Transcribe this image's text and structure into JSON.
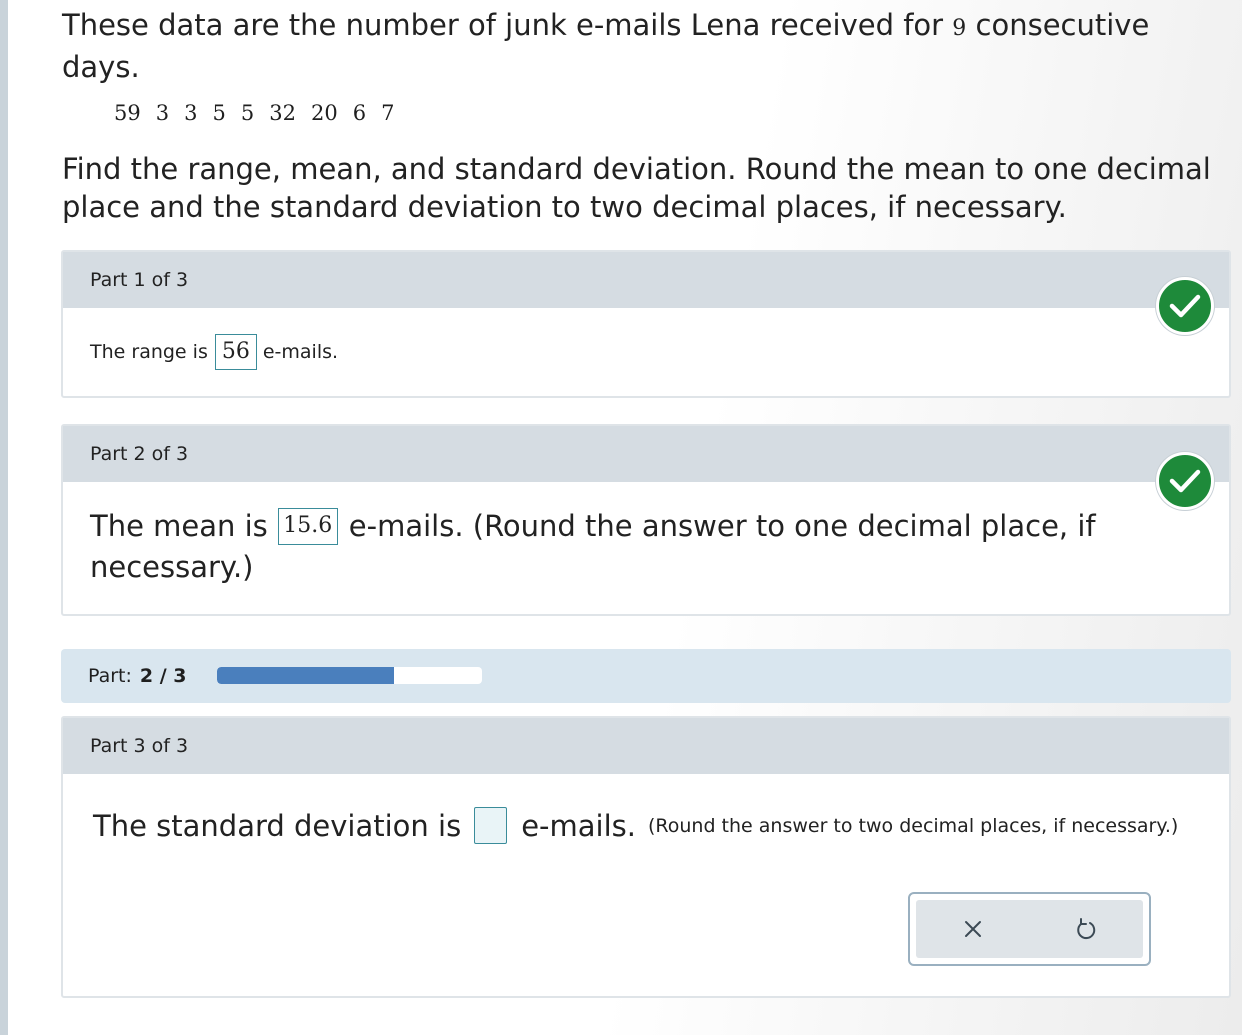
{
  "question": {
    "text_before": "These data are the number of junk e-mails Lena received for",
    "count": "9",
    "text_after": "consecutive days.",
    "values": [
      "59",
      "3",
      "3",
      "5",
      "5",
      "32",
      "20",
      "6",
      "7"
    ],
    "instructions": "Find the range, mean, and standard deviation. Round the mean to one decimal place and the standard deviation to two decimal places, if necessary."
  },
  "part1": {
    "header": "Part 1 of 3",
    "prefix": "The range is",
    "answer": "56",
    "suffix": "e-mails."
  },
  "part2": {
    "header": "Part 2 of 3",
    "prefix": "The mean is",
    "answer": "15.6",
    "suffix": "e-mails. (Round the answer to one decimal place, if",
    "suffix2": "necessary.)"
  },
  "progress": {
    "label": "Part:",
    "value": "2 / 3",
    "fraction": 0.667
  },
  "part3": {
    "header": "Part 3 of 3",
    "prefix": "The standard deviation is",
    "answer": "",
    "suffix": "e-mails.",
    "note": "(Round the answer to two decimal places, if necessary.)"
  },
  "colors": {
    "correct": "#1e8a3a",
    "progress_fill": "#4a7fbd",
    "header_bg": "#d5dce2"
  },
  "icons": [
    "check-icon",
    "close-icon",
    "undo-icon"
  ]
}
